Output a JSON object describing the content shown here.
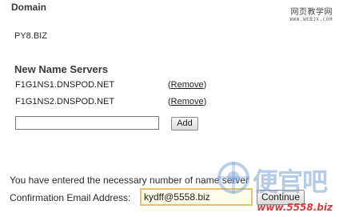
{
  "watermark_top": {
    "chinese": "网页教学网",
    "url": "WWW.WEBJX.COM"
  },
  "domain_section": {
    "title": "Domain",
    "value": "PY8.BIZ"
  },
  "name_servers": {
    "title": "New Name Servers",
    "items": [
      {
        "name": "F1G1NS1.DNSPOD.NET",
        "remove_label": "Remove"
      },
      {
        "name": "F1G1NS2.DNSPOD.NET",
        "remove_label": "Remove"
      }
    ],
    "new_ns_value": "",
    "add_label": "Add"
  },
  "notice": "You have entered the necessary number of name servers.",
  "confirmation": {
    "label": "Confirmation Email Address:",
    "email_value": "kydff@5558.biz",
    "continue_label": "Continue"
  },
  "watermark_bottom": {
    "brand": "便官吧",
    "url": "www.5558.biz"
  },
  "colors": {
    "watermark_url": "#d04040",
    "email_highlight_border": "#e4c36a",
    "email_highlight_bg": "#fffce8"
  }
}
